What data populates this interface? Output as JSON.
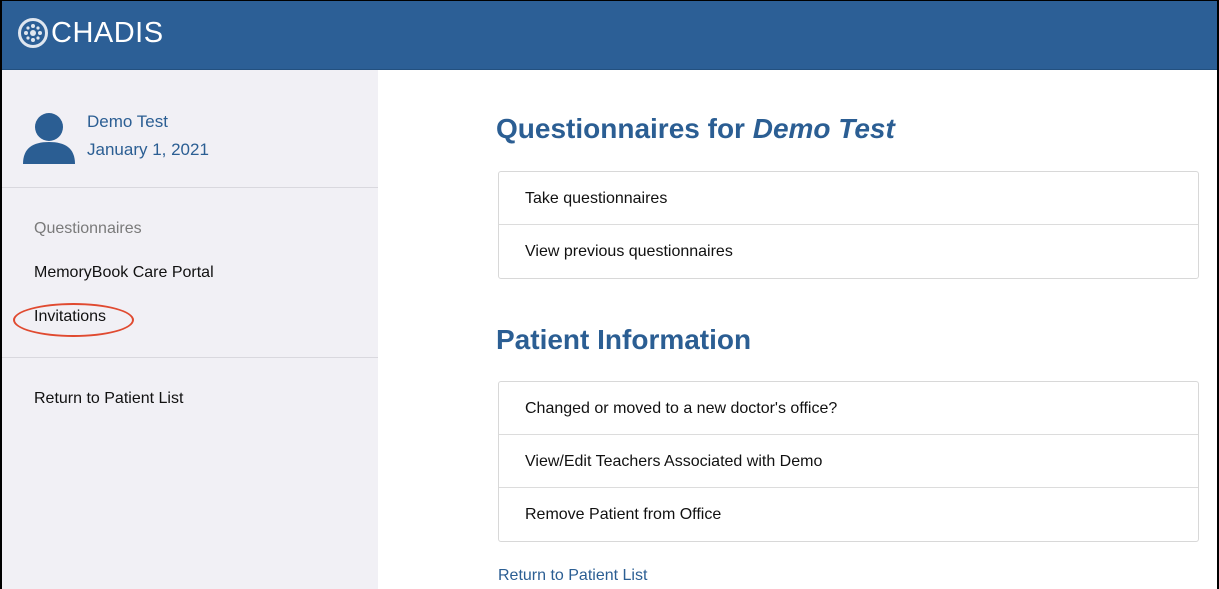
{
  "app": {
    "brand": "CHADIS",
    "logo_icon": "chadis-logo-icon"
  },
  "sidebar": {
    "patient_name": "Demo Test",
    "patient_dob": "January 1, 2021",
    "avatar_icon": "user-avatar-icon",
    "section_label": "Questionnaires",
    "items": [
      {
        "label": "MemoryBook Care Portal"
      },
      {
        "label": "Invitations"
      }
    ],
    "return_label": "Return to Patient List",
    "annotation_color": "#e04a30"
  },
  "main": {
    "questionnaires_title_prefix": "Questionnaires for ",
    "questionnaires_title_name": "Demo Test",
    "questionnaire_items": [
      {
        "label": "Take questionnaires"
      },
      {
        "label": "View previous questionnaires"
      }
    ],
    "patient_info_title": "Patient Information",
    "patient_info_items": [
      {
        "label": "Changed or moved to a new doctor's office?"
      },
      {
        "label": "View/Edit Teachers Associated with Demo"
      },
      {
        "label": "Remove Patient from Office"
      }
    ],
    "return_link": "Return to Patient List"
  },
  "colors": {
    "header_bg": "#2c5f96",
    "sidebar_bg": "#f1f0f5",
    "accent": "#2b5e93"
  }
}
